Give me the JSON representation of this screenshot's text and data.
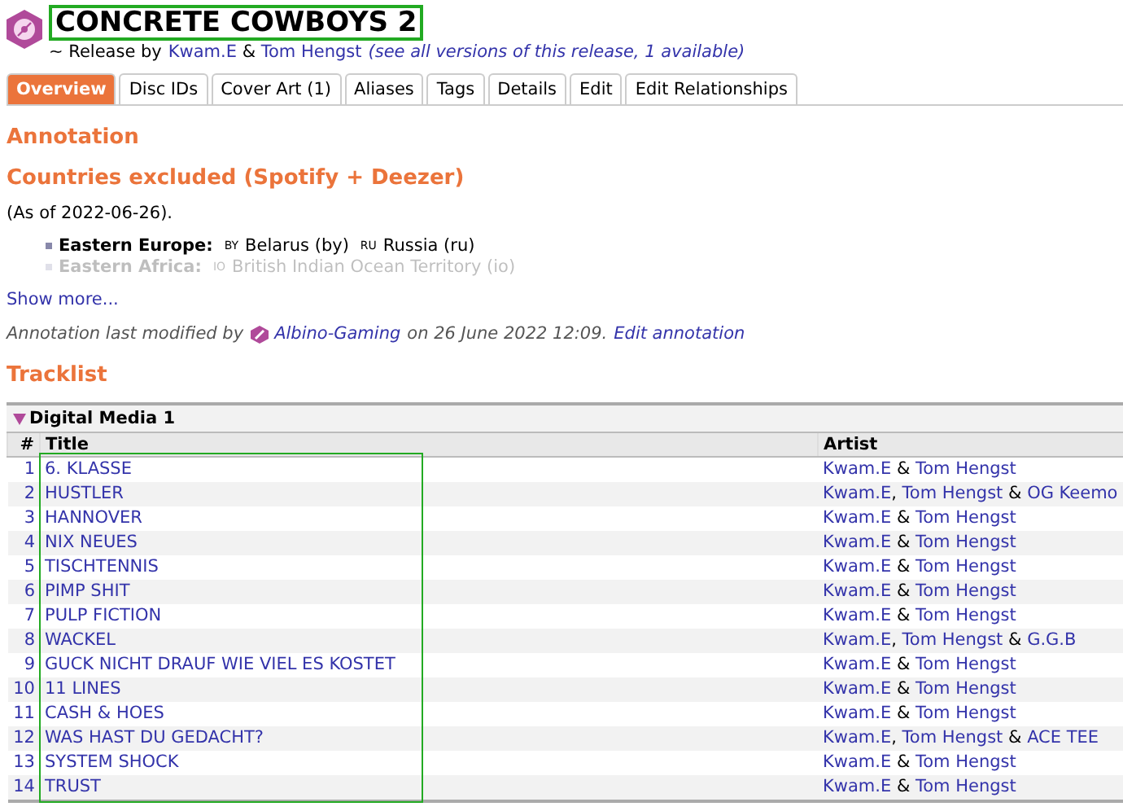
{
  "header": {
    "title": "CONCRETE COWBOYS 2",
    "subtitle_prefix": "~ Release by",
    "artists": [
      {
        "name": "Kwam.E",
        "join": " & "
      },
      {
        "name": "Tom Hengst"
      }
    ],
    "versions_link": "(see all versions of this release, 1 available)"
  },
  "tabs": [
    {
      "label": "Overview",
      "selected": true
    },
    {
      "label": "Disc IDs",
      "selected": false
    },
    {
      "label": "Cover Art (1)",
      "selected": false
    },
    {
      "label": "Aliases",
      "selected": false
    },
    {
      "label": "Tags",
      "selected": false
    },
    {
      "label": "Details",
      "selected": false
    },
    {
      "label": "Edit",
      "selected": false
    },
    {
      "label": "Edit Relationships",
      "selected": false
    }
  ],
  "annotation": {
    "heading": "Annotation",
    "subheading": "Countries excluded (Spotify + Deezer)",
    "note": "(As of 2022-06-26).",
    "regions": [
      {
        "region": "Eastern Europe:",
        "countries": [
          {
            "code": "BY",
            "name": "Belarus (by)"
          },
          {
            "code": "RU",
            "name": "Russia (ru)"
          }
        ],
        "faded": false
      },
      {
        "region": "Eastern Africa:",
        "countries": [
          {
            "code": "IO",
            "name": "British Indian Ocean Territory (io)"
          }
        ],
        "faded": true
      }
    ],
    "show_more": "Show more...",
    "modified_prefix": "Annotation last modified by",
    "editor": "Albino-Gaming",
    "modified_suffix": "on 26 June 2022 12:09.",
    "edit_link": "Edit annotation"
  },
  "tracklist": {
    "heading": "Tracklist",
    "medium": "Digital Media 1",
    "expanded": true,
    "columns": [
      "#",
      "Title",
      "Artist"
    ],
    "rows": [
      {
        "number": "1",
        "title": "6. KLASSE",
        "artists": [
          {
            "name": "Kwam.E",
            "join": " & "
          },
          {
            "name": "Tom Hengst"
          }
        ]
      },
      {
        "number": "2",
        "title": "HUSTLER",
        "artists": [
          {
            "name": "Kwam.E",
            "join": ", "
          },
          {
            "name": "Tom Hengst",
            "join": " & "
          },
          {
            "name": "OG Keemo"
          }
        ]
      },
      {
        "number": "3",
        "title": "HANNOVER",
        "artists": [
          {
            "name": "Kwam.E",
            "join": " & "
          },
          {
            "name": "Tom Hengst"
          }
        ]
      },
      {
        "number": "4",
        "title": "NIX NEUES",
        "artists": [
          {
            "name": "Kwam.E",
            "join": " & "
          },
          {
            "name": "Tom Hengst"
          }
        ]
      },
      {
        "number": "5",
        "title": "TISCHTENNIS",
        "artists": [
          {
            "name": "Kwam.E",
            "join": " & "
          },
          {
            "name": "Tom Hengst"
          }
        ]
      },
      {
        "number": "6",
        "title": "PIMP SHIT",
        "artists": [
          {
            "name": "Kwam.E",
            "join": " & "
          },
          {
            "name": "Tom Hengst"
          }
        ]
      },
      {
        "number": "7",
        "title": "PULP FICTION",
        "artists": [
          {
            "name": "Kwam.E",
            "join": " & "
          },
          {
            "name": "Tom Hengst"
          }
        ]
      },
      {
        "number": "8",
        "title": "WACKEL",
        "artists": [
          {
            "name": "Kwam.E",
            "join": ", "
          },
          {
            "name": "Tom Hengst",
            "join": " & "
          },
          {
            "name": "G.G.B"
          }
        ]
      },
      {
        "number": "9",
        "title": "GUCK NICHT DRAUF WIE VIEL ES KOSTET",
        "artists": [
          {
            "name": "Kwam.E",
            "join": " & "
          },
          {
            "name": "Tom Hengst"
          }
        ]
      },
      {
        "number": "10",
        "title": "11 LINES",
        "artists": [
          {
            "name": "Kwam.E",
            "join": " & "
          },
          {
            "name": "Tom Hengst"
          }
        ]
      },
      {
        "number": "11",
        "title": "CASH & HOES",
        "artists": [
          {
            "name": "Kwam.E",
            "join": " & "
          },
          {
            "name": "Tom Hengst"
          }
        ]
      },
      {
        "number": "12",
        "title": "WAS HAST DU GEDACHT?",
        "artists": [
          {
            "name": "Kwam.E",
            "join": ", "
          },
          {
            "name": "Tom Hengst",
            "join": " & "
          },
          {
            "name": "ACE TEE"
          }
        ]
      },
      {
        "number": "13",
        "title": "SYSTEM SHOCK",
        "artists": [
          {
            "name": "Kwam.E",
            "join": " & "
          },
          {
            "name": "Tom Hengst"
          }
        ]
      },
      {
        "number": "14",
        "title": "TRUST",
        "artists": [
          {
            "name": "Kwam.E",
            "join": " & "
          },
          {
            "name": "Tom Hengst"
          }
        ]
      }
    ]
  }
}
